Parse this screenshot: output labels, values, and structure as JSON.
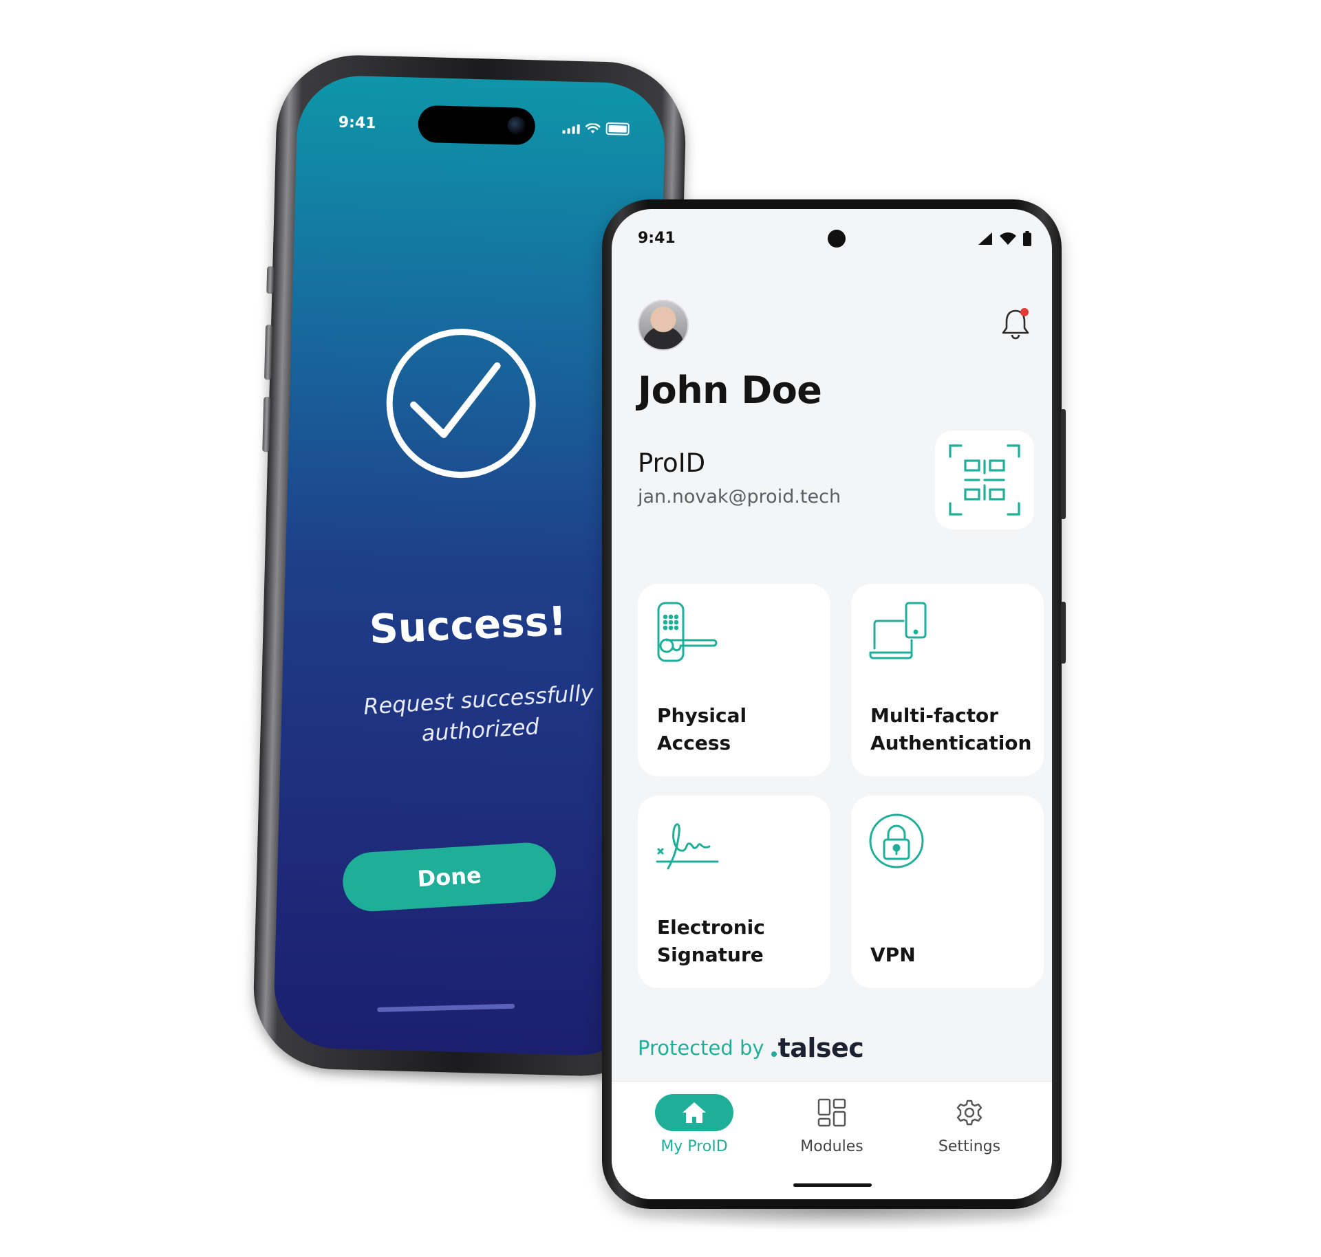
{
  "ios": {
    "time": "9:41",
    "success_title": "Success!",
    "success_subtitle": "Request successfully authorized",
    "done_label": "Done"
  },
  "android": {
    "time": "9:41",
    "user_name": "John Doe",
    "product_name": "ProID",
    "email": "jan.novak@proid.tech",
    "tiles": [
      {
        "label": "Physical Access",
        "icon": "door-lock-icon"
      },
      {
        "label": "Multi-factor Authentication",
        "icon": "laptop-phone-icon"
      },
      {
        "label": "Electronic Signature",
        "icon": "signature-icon"
      },
      {
        "label": "VPN",
        "icon": "padlock-icon"
      }
    ],
    "protected_prefix": "Protected by",
    "protected_brand": "talsec",
    "nav": [
      {
        "label": "My ProID",
        "icon": "home-icon",
        "active": true
      },
      {
        "label": "Modules",
        "icon": "modules-grid-icon",
        "active": false
      },
      {
        "label": "Settings",
        "icon": "gear-icon",
        "active": false
      }
    ]
  },
  "colors": {
    "accent": "#1fae98",
    "ios_gradient_top": "#0e96a8",
    "ios_gradient_bottom": "#1b1f6e",
    "notification_dot": "#e53935"
  }
}
